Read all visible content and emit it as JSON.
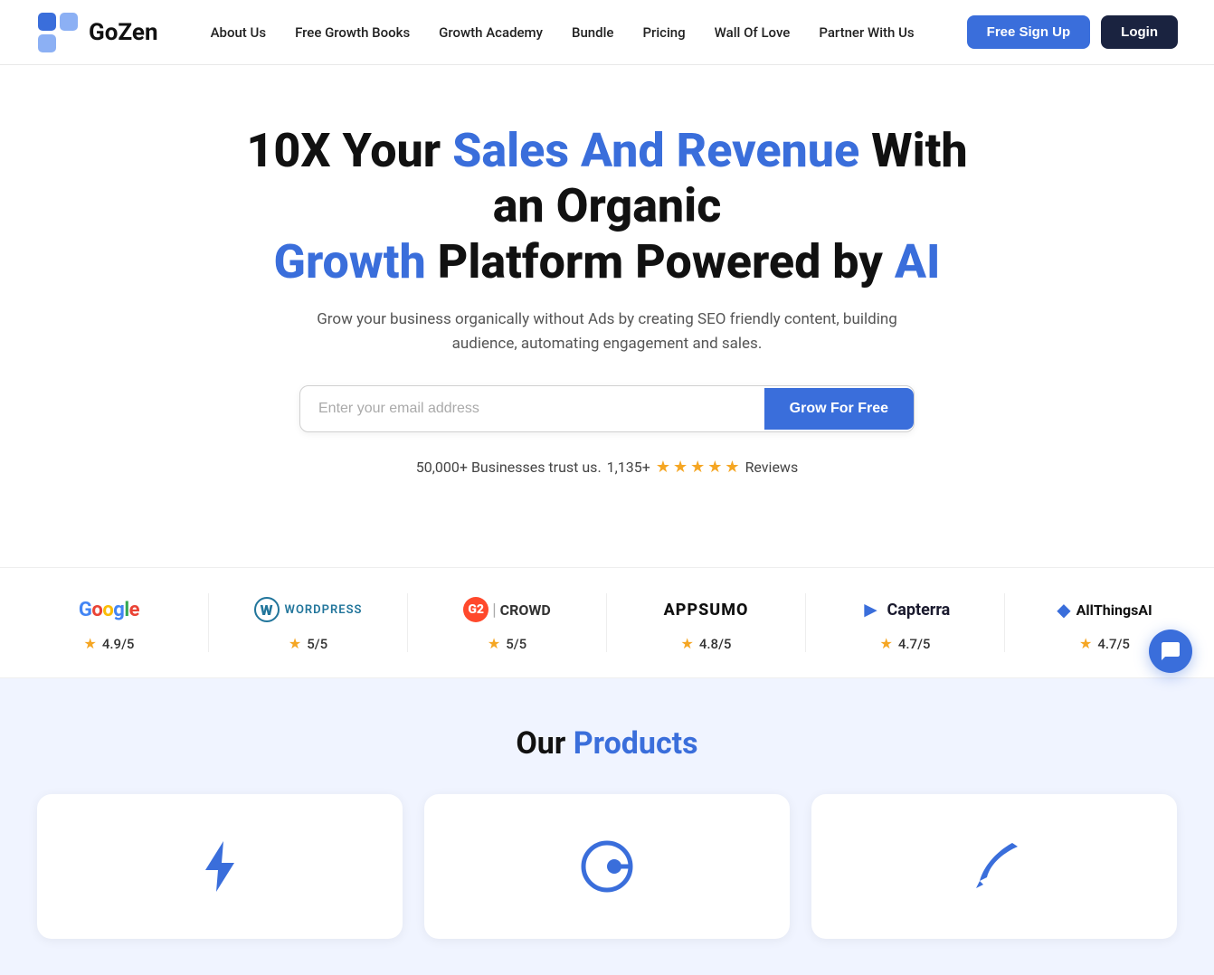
{
  "brand": {
    "name": "GoZen",
    "logo_alt": "GoZen logo"
  },
  "nav": {
    "links": [
      {
        "id": "about-us",
        "label": "About Us",
        "href": "#"
      },
      {
        "id": "free-growth-books",
        "label": "Free Growth Books",
        "href": "#"
      },
      {
        "id": "growth-academy",
        "label": "Growth Academy",
        "href": "#"
      },
      {
        "id": "bundle",
        "label": "Bundle",
        "href": "#"
      },
      {
        "id": "pricing",
        "label": "Pricing",
        "href": "#"
      },
      {
        "id": "wall-of-love",
        "label": "Wall Of Love",
        "href": "#"
      },
      {
        "id": "partner-with-us",
        "label": "Partner With Us",
        "href": "#"
      }
    ],
    "free_signup_label": "Free Sign Up",
    "login_label": "Login"
  },
  "hero": {
    "headline_prefix": "10X Your ",
    "headline_highlight": "Sales And Revenue",
    "headline_middle": " With an Organic ",
    "headline_highlight2": "Growth",
    "headline_suffix": " Platform Powered by ",
    "headline_ai": "AI",
    "subtext": "Grow your business organically without Ads by creating SEO friendly content, building audience, automating engagement and sales.",
    "email_placeholder": "Enter your email address",
    "cta_button": "Grow For Free"
  },
  "trust": {
    "text_prefix": "50,000+ Businesses trust us.",
    "count": "1,135+",
    "text_suffix": "Reviews",
    "star_count": 5
  },
  "ratings": [
    {
      "id": "google",
      "type": "google",
      "score": "4.9/5"
    },
    {
      "id": "wordpress",
      "type": "wordpress",
      "score": "5/5"
    },
    {
      "id": "g2crowd",
      "type": "g2crowd",
      "score": "5/5"
    },
    {
      "id": "appsumo",
      "type": "appsumo",
      "score": "4.8/5"
    },
    {
      "id": "capterra",
      "type": "capterra",
      "score": "4.7/5"
    },
    {
      "id": "allthingsai",
      "type": "allthingsai",
      "score": "4.7/5"
    }
  ],
  "products_section": {
    "heading_prefix": "Our ",
    "heading_highlight": "Products"
  },
  "products": [
    {
      "id": "product-1",
      "icon_type": "lightning"
    },
    {
      "id": "product-2",
      "icon_type": "engage"
    },
    {
      "id": "product-3",
      "icon_type": "quill"
    }
  ]
}
